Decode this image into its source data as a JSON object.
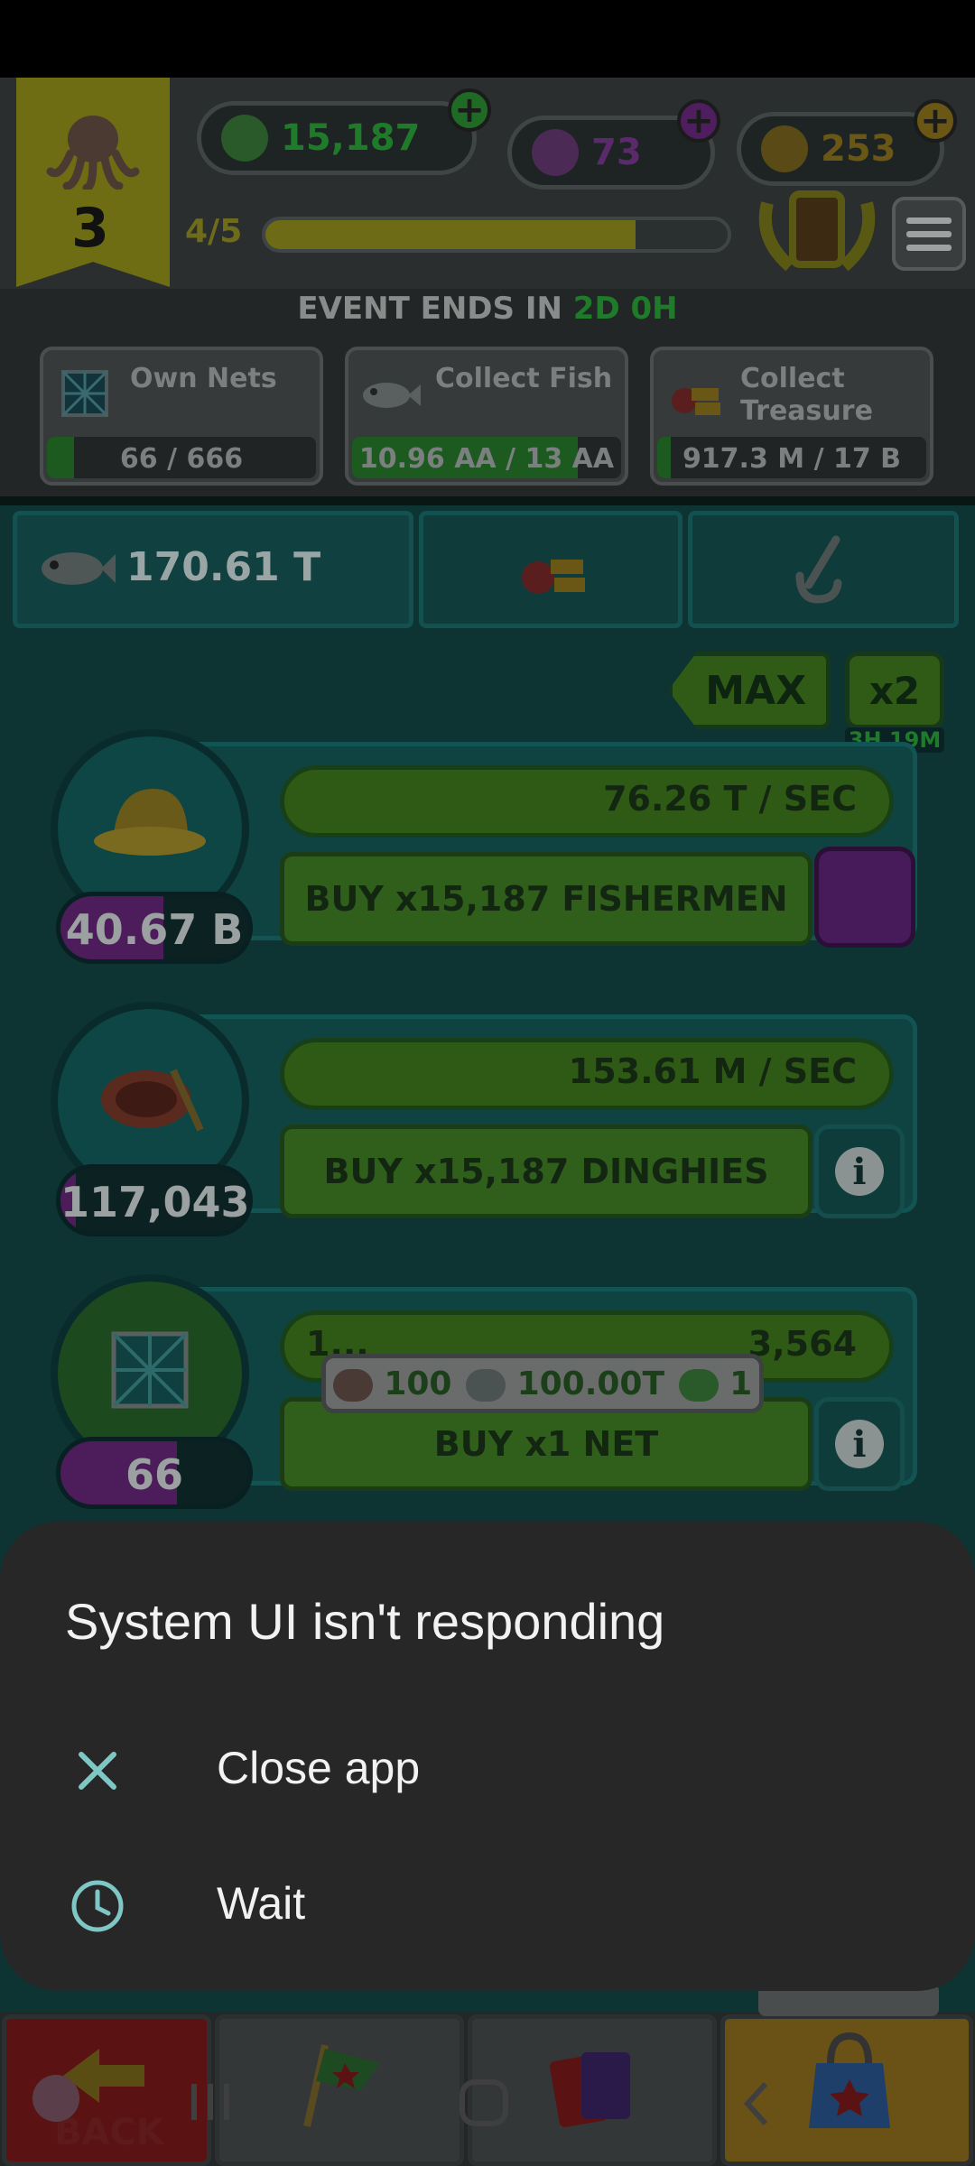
{
  "header": {
    "level": "3",
    "currencies": [
      {
        "icon": "diving-helmet-icon",
        "value": "15,187",
        "color": "#2e8f2f"
      },
      {
        "icon": "potion-bottle-icon",
        "value": "73",
        "color": "#7a2f8a"
      },
      {
        "icon": "gold-bar-icon",
        "value": "253",
        "color": "#8a6d18"
      }
    ],
    "progress_label": "4/5",
    "progress": 0.8
  },
  "event": {
    "prefix": "EVENT ENDS IN ",
    "time": "2D 0H",
    "cards": [
      {
        "title": "Own Nets",
        "progress_text": "66 / 666",
        "progress": 0.1,
        "icon": "net-icon"
      },
      {
        "title": "Collect Fish",
        "progress_text": "10.96 AA / 13 AA",
        "progress": 0.84,
        "icon": "fish-icon"
      },
      {
        "title": "Collect Treasure",
        "title_line1": "Collect",
        "title_line2": "Treasure",
        "progress_text": "917.3 M / 17 B",
        "progress": 0.05,
        "icon": "treasure-icon"
      }
    ]
  },
  "tabs": {
    "fish_total": "170.61 T"
  },
  "multiplier": {
    "max_label": "MAX",
    "boost_label": "x2",
    "boost_time": "3H 19M"
  },
  "rows": [
    {
      "name": "fishermen",
      "count": "40.67 B",
      "count_fill": 0.55,
      "rate": "76.26 T / SEC",
      "buy": "BUY x15,187 FISHERMEN",
      "action": "upgrade"
    },
    {
      "name": "dinghies",
      "count": "117,043",
      "count_fill": 0.08,
      "rate": "153.61 M / SEC",
      "buy": "BUY x15,187 DINGHIES",
      "action": "info"
    },
    {
      "name": "nets",
      "count": "66",
      "count_fill": 0.62,
      "rate_left": "1...",
      "rate": "3,564",
      "buy": "BUY x1 NET",
      "action": "info"
    }
  ],
  "tooltip": {
    "dinghy_cost": "100",
    "fish_cost": "100.00T",
    "helmet_cost": "1"
  },
  "bottom_nav": {
    "back_label": "BACK"
  },
  "dialog": {
    "title": "System UI isn't responding",
    "close_label": "Close app",
    "wait_label": "Wait",
    "accent": "#7fc7c4"
  }
}
